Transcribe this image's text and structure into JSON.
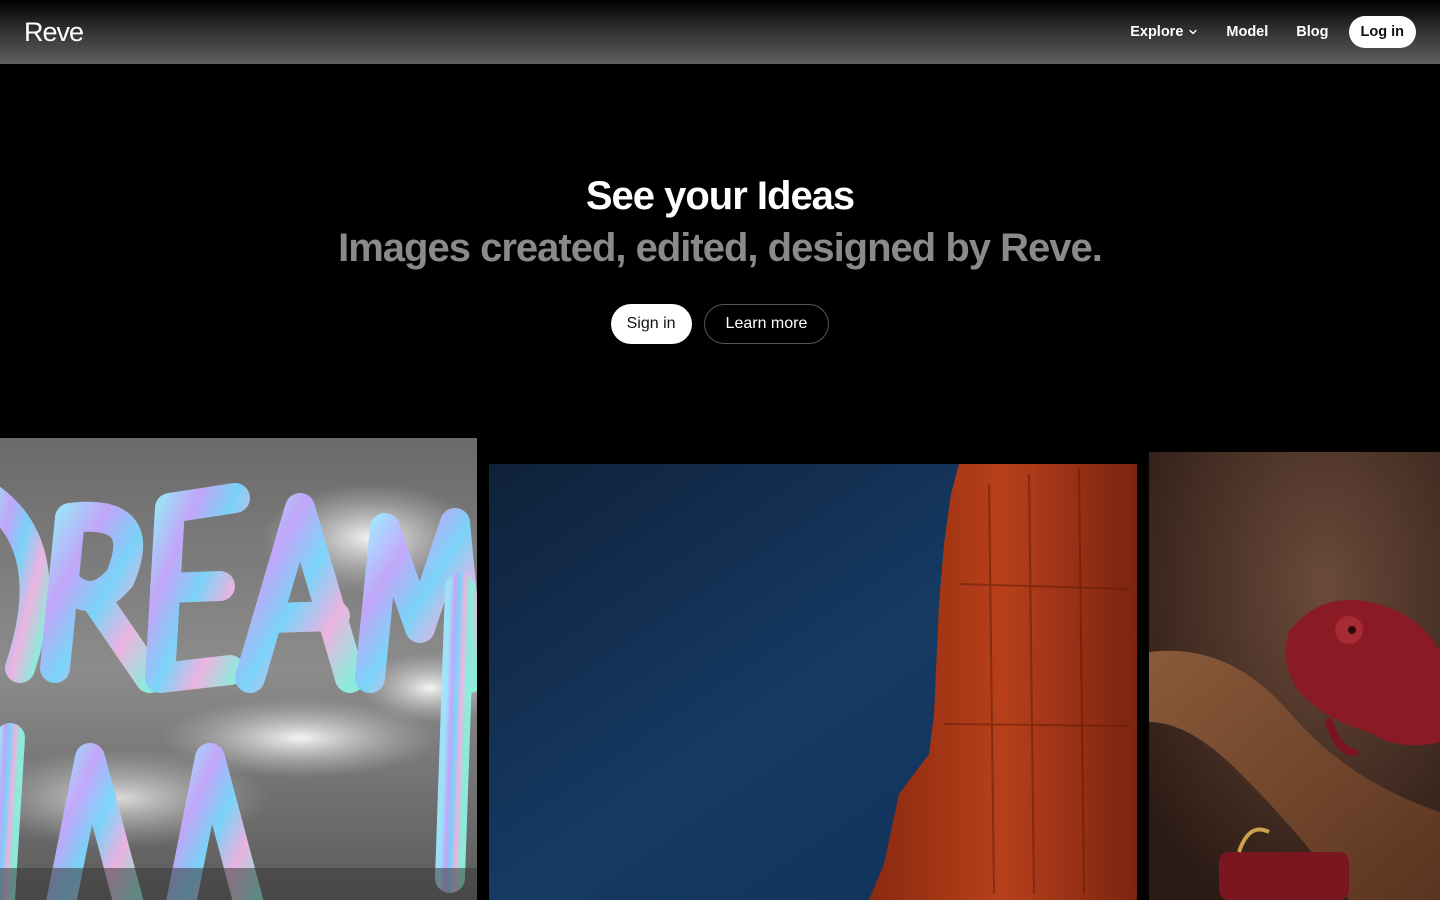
{
  "header": {
    "logo": "Reve",
    "nav": [
      {
        "label": "Explore",
        "has_dropdown": true
      },
      {
        "label": "Model"
      },
      {
        "label": "Blog"
      }
    ],
    "login_label": "Log in"
  },
  "hero": {
    "title": "See your Ideas",
    "subtitle": "Images created, edited, designed by Reve.",
    "primary_cta": "Sign in",
    "secondary_cta": "Learn more"
  },
  "gallery": [
    {
      "name": "dream-lettering-clouds"
    },
    {
      "name": "red-rock-blue-sky"
    },
    {
      "name": "red-chameleon-branch"
    }
  ],
  "colors": {
    "background": "#000000",
    "subtitle": "#8a8a8a",
    "button_light": "#ffffff"
  }
}
